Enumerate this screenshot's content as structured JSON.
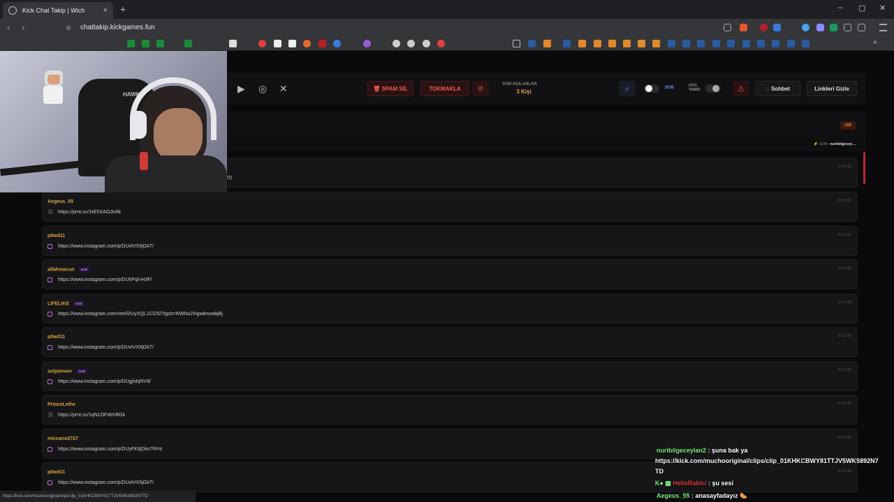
{
  "browser": {
    "tab_title": "Kick Chat Takip | Wich",
    "tab_close": "×",
    "new_tab": "+",
    "url": "chattakip.kickgames.fun",
    "status_url": "https://kick.com/muchooriginal/clips/clip_01KHKCBWY81TTJV5WK5892N7TD",
    "controls": {
      "minimize": "–",
      "maximize": "▢",
      "close": "✕"
    }
  },
  "header": {
    "spam_button": "SPAM SİL",
    "tokmakla_button": "TOKMAKLA",
    "son_acilanlar_label": "SON AÇILANLAR",
    "son_acilanlar_value": "3 Kişi",
    "sub_label": "SUB",
    "oto_label": "OTO",
    "temiz_label": "TEMİZ",
    "sohbet_button": "Sohbet",
    "linkleri_gizle_button": "Linkleri Gizle"
  },
  "panel": {
    "count_badge": "100",
    "son_label": "SON:",
    "son_user": "nuribilgecey…"
  },
  "first_row_partial": "TD",
  "link_rows": [
    {
      "user": "Aegeus_55",
      "sub": false,
      "icon": "link-icon",
      "link": "https://prnt.sc/JxE5XAOJiv6k",
      "time": "20:13:20"
    },
    {
      "user": "p0wd11",
      "sub": false,
      "icon": "instagram-icon",
      "link": "https://www.instagram.com/p/DUvtVX5jGkT/",
      "time": "20:12:57"
    },
    {
      "user": "allahmacun",
      "sub": true,
      "icon": "instagram-icon",
      "link": "https://www.instagram.com/p/DUhPql-iH3F/",
      "time": "20:12:54"
    },
    {
      "user": "LIFELIKE",
      "sub": true,
      "icon": "instagram-icon",
      "link": "https://www.instagram.com/reel/DUyXQL1Cl2S/?igsh=NWNoZHgwbnowbjBj",
      "time": "20:12:43"
    },
    {
      "user": "p0wd11",
      "sub": false,
      "icon": "instagram-icon",
      "link": "https://www.instagram.com/p/DUvtVX5jGkT/",
      "time": "20:12:30"
    },
    {
      "user": "solpioneer",
      "sub": true,
      "icon": "instagram-icon",
      "link": "https://www.instagram.com/p/DUgjisbjNV8/",
      "time": "20:12:21"
    },
    {
      "user": "PrinceLethe",
      "sub": false,
      "icon": "link-icon",
      "link": "https://prnt.sc/1qN1OFxbVBGk",
      "time": "20:12:18"
    },
    {
      "user": "miccano2727",
      "sub": false,
      "icon": "instagram-icon",
      "link": "https://www.instagram.com/p/DUyFK8jDkn?hl=tr",
      "time": "20:12:14"
    },
    {
      "user": "p0wd11",
      "sub": false,
      "icon": "instagram-icon",
      "link": "https://www.instagram.com/p/DUvtVX5jGkT/",
      "time": "20:10:43"
    }
  ],
  "sub_badge": "SUB",
  "first_row_time": "20:13:31",
  "overlay_chat": [
    {
      "user": "nuribilgeceylan2",
      "text": " : şuna bak ya"
    },
    {
      "user": "",
      "text": "https://kick.com/muchooriginal/clips/clip_01KHKCBWY81TTJV5WK5892N7"
    },
    {
      "user": "",
      "text": "TD"
    },
    {
      "user": "HelixRakici",
      "text": " : şu sesi"
    },
    {
      "user": "Aegeus_55",
      "text": " : anasayfadayız"
    }
  ],
  "cam": {
    "chair_text": "HAWK"
  },
  "colors": {
    "accent_red": "#f05a4a",
    "username_gold": "#d9a43b",
    "sub_purple": "#b27af0",
    "count_orange": "#f07a4a"
  }
}
